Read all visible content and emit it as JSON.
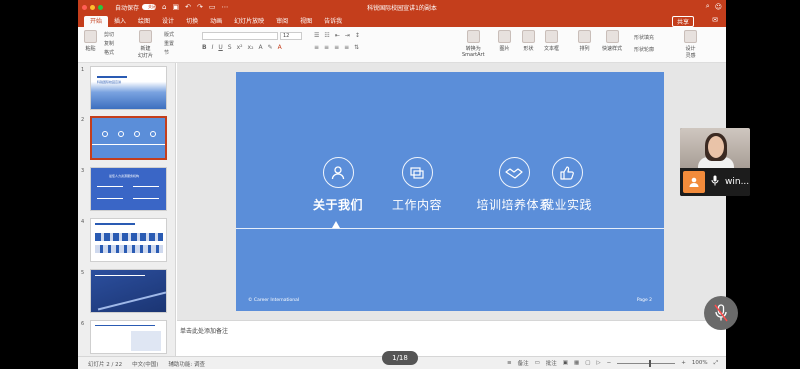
{
  "titlebar": {
    "autosave_label": "自动保存",
    "autosave_state": "关闭",
    "doc_title": "科锐国际校园宣讲1的副本",
    "colors": {
      "accent": "#c43e1c"
    }
  },
  "tabs": [
    "开始",
    "插入",
    "绘图",
    "设计",
    "切换",
    "动画",
    "幻灯片放映",
    "审阅",
    "视图",
    "告诉我"
  ],
  "share_label": "共享",
  "ribbon": {
    "paste": "粘贴",
    "cut": "剪切",
    "copy": "复制",
    "format": "格式",
    "new_slide": "新建\n幻灯片",
    "layout": "版式",
    "reset": "重置",
    "section": "节",
    "font_size": "12",
    "convert_smartart": "转换为\nSmartArt",
    "picture": "图片",
    "shape": "形状",
    "textbox": "文本框",
    "arrange": "排列",
    "quick_styles": "快速样式",
    "shape_fill": "形状填充",
    "shape_outline": "形状轮廓",
    "designer": "设计\n灵感"
  },
  "thumbnails": [
    {
      "num": "1",
      "title": "科锐国际校园宣讲"
    },
    {
      "num": "2",
      "title": "关于我们"
    },
    {
      "num": "3",
      "title": "最佳人力资源服务机构"
    },
    {
      "num": "4",
      "title": ""
    },
    {
      "num": "5",
      "title": ""
    },
    {
      "num": "6",
      "title": ""
    }
  ],
  "slide": {
    "menu": [
      {
        "label": "关于我们",
        "icon": "person-icon",
        "active": true
      },
      {
        "label": "工作内容",
        "icon": "card-icon",
        "active": false
      },
      {
        "label": "培训培养体系",
        "icon": "handshake-icon",
        "active": false
      },
      {
        "label": "就业实践",
        "icon": "thumbsup-icon",
        "active": false
      }
    ],
    "footer_left": "© Career International",
    "footer_right": "Page 2",
    "bg_color": "#5b8ed9"
  },
  "notes_placeholder": "单击此处添加备注",
  "status": {
    "slide_info": "幻灯片 2 / 22",
    "language": "中文(中国)",
    "accessibility": "辅助功能: 调查",
    "notes": "备注",
    "comments": "批注",
    "zoom": "100%"
  },
  "page_indicator": "1/18",
  "video": {
    "name": "win..."
  }
}
